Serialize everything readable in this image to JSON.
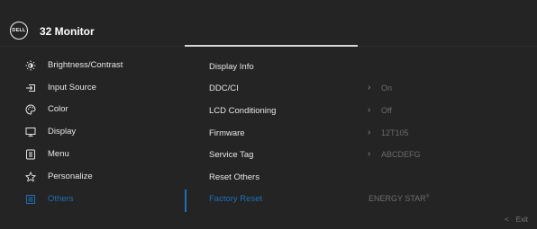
{
  "header": {
    "logo": "DELL",
    "title": "32 Monitor"
  },
  "menu": [
    {
      "label": "Brightness/Contrast",
      "icon": "brightness-icon"
    },
    {
      "label": "Input Source",
      "icon": "input-source-icon"
    },
    {
      "label": "Color",
      "icon": "color-palette-icon"
    },
    {
      "label": "Display",
      "icon": "display-icon"
    },
    {
      "label": "Menu",
      "icon": "menu-icon"
    },
    {
      "label": "Personalize",
      "icon": "star-icon"
    },
    {
      "label": "Others",
      "icon": "others-icon"
    }
  ],
  "others": [
    {
      "label": "Display Info"
    },
    {
      "label": "DDC/CI",
      "value": "On"
    },
    {
      "label": "LCD Conditioning",
      "value": "Off"
    },
    {
      "label": "Firmware",
      "value": "12T105"
    },
    {
      "label": "Service Tag",
      "value": "ABCDEFG"
    },
    {
      "label": "Reset Others"
    },
    {
      "label": "Factory Reset"
    }
  ],
  "energy_star": "ENERGY STAR",
  "energy_star_mark": "®",
  "exit": {
    "chevron": "<",
    "label": "Exit"
  },
  "colors": {
    "accent": "#1e6fb9",
    "background": "#242424",
    "text": "#e6e6e6"
  }
}
